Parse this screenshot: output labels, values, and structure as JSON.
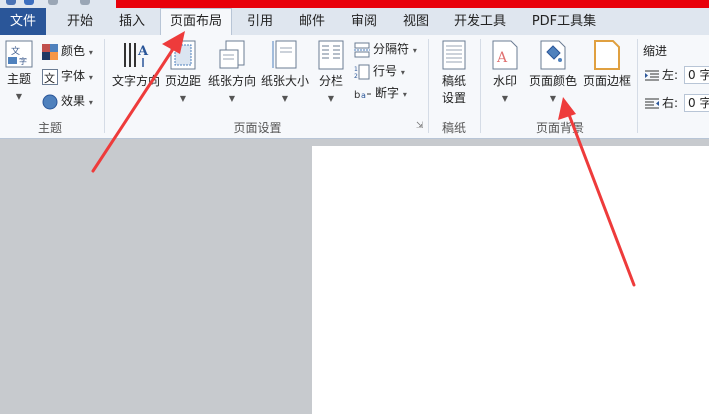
{
  "tabs": {
    "file": "文件",
    "home": "开始",
    "insert": "插入",
    "page_layout": "页面布局",
    "references": "引用",
    "mailings": "邮件",
    "review": "审阅",
    "view": "视图",
    "developer": "开发工具",
    "pdf_tools": "PDF工具集"
  },
  "themes_group": {
    "themes": "主题",
    "colors": "颜色",
    "fonts": "字体",
    "effects": "效果",
    "label": "主题"
  },
  "page_setup_group": {
    "text_direction": "文字方向",
    "margins": "页边距",
    "orientation": "纸张方向",
    "size": "纸张大小",
    "columns": "分栏",
    "breaks": "分隔符",
    "line_numbers": "行号",
    "hyphenation": "断字",
    "label": "页面设置"
  },
  "manuscript_group": {
    "manuscript_settings_line1": "稿纸",
    "manuscript_settings_line2": "设置",
    "label": "稿纸"
  },
  "page_background_group": {
    "watermark": "水印",
    "page_color": "页面颜色",
    "page_borders": "页面边框",
    "label": "页面背景"
  },
  "paragraph_group": {
    "indent_title": "缩进",
    "left_label": "左:",
    "left_value": "0 字",
    "right_label": "右:",
    "right_value": "0 字"
  },
  "colors": {
    "file_tab": "#2a5699",
    "title_bar_red": "#e8000a",
    "annotation_arrow": "#ee3b3b"
  }
}
